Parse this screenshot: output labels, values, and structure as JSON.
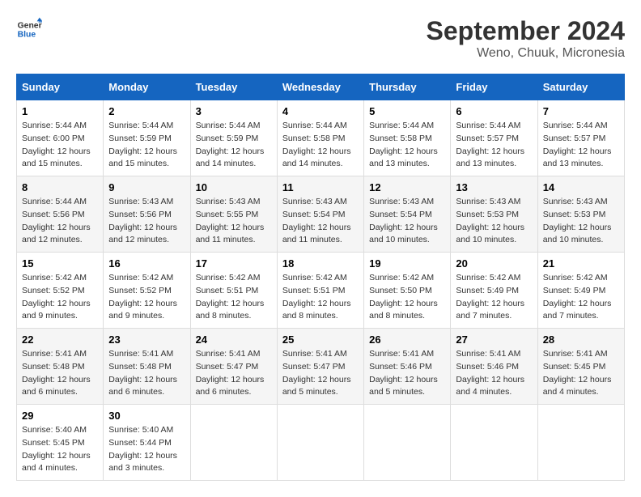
{
  "header": {
    "logo_line1": "General",
    "logo_line2": "Blue",
    "title": "September 2024",
    "subtitle": "Weno, Chuuk, Micronesia"
  },
  "columns": [
    "Sunday",
    "Monday",
    "Tuesday",
    "Wednesday",
    "Thursday",
    "Friday",
    "Saturday"
  ],
  "weeks": [
    [
      {
        "day": "1",
        "sunrise": "5:44 AM",
        "sunset": "6:00 PM",
        "daylight": "12 hours and 15 minutes."
      },
      {
        "day": "2",
        "sunrise": "5:44 AM",
        "sunset": "5:59 PM",
        "daylight": "12 hours and 15 minutes."
      },
      {
        "day": "3",
        "sunrise": "5:44 AM",
        "sunset": "5:59 PM",
        "daylight": "12 hours and 14 minutes."
      },
      {
        "day": "4",
        "sunrise": "5:44 AM",
        "sunset": "5:58 PM",
        "daylight": "12 hours and 14 minutes."
      },
      {
        "day": "5",
        "sunrise": "5:44 AM",
        "sunset": "5:58 PM",
        "daylight": "12 hours and 13 minutes."
      },
      {
        "day": "6",
        "sunrise": "5:44 AM",
        "sunset": "5:57 PM",
        "daylight": "12 hours and 13 minutes."
      },
      {
        "day": "7",
        "sunrise": "5:44 AM",
        "sunset": "5:57 PM",
        "daylight": "12 hours and 13 minutes."
      }
    ],
    [
      {
        "day": "8",
        "sunrise": "5:44 AM",
        "sunset": "5:56 PM",
        "daylight": "12 hours and 12 minutes."
      },
      {
        "day": "9",
        "sunrise": "5:43 AM",
        "sunset": "5:56 PM",
        "daylight": "12 hours and 12 minutes."
      },
      {
        "day": "10",
        "sunrise": "5:43 AM",
        "sunset": "5:55 PM",
        "daylight": "12 hours and 11 minutes."
      },
      {
        "day": "11",
        "sunrise": "5:43 AM",
        "sunset": "5:54 PM",
        "daylight": "12 hours and 11 minutes."
      },
      {
        "day": "12",
        "sunrise": "5:43 AM",
        "sunset": "5:54 PM",
        "daylight": "12 hours and 10 minutes."
      },
      {
        "day": "13",
        "sunrise": "5:43 AM",
        "sunset": "5:53 PM",
        "daylight": "12 hours and 10 minutes."
      },
      {
        "day": "14",
        "sunrise": "5:43 AM",
        "sunset": "5:53 PM",
        "daylight": "12 hours and 10 minutes."
      }
    ],
    [
      {
        "day": "15",
        "sunrise": "5:42 AM",
        "sunset": "5:52 PM",
        "daylight": "12 hours and 9 minutes."
      },
      {
        "day": "16",
        "sunrise": "5:42 AM",
        "sunset": "5:52 PM",
        "daylight": "12 hours and 9 minutes."
      },
      {
        "day": "17",
        "sunrise": "5:42 AM",
        "sunset": "5:51 PM",
        "daylight": "12 hours and 8 minutes."
      },
      {
        "day": "18",
        "sunrise": "5:42 AM",
        "sunset": "5:51 PM",
        "daylight": "12 hours and 8 minutes."
      },
      {
        "day": "19",
        "sunrise": "5:42 AM",
        "sunset": "5:50 PM",
        "daylight": "12 hours and 8 minutes."
      },
      {
        "day": "20",
        "sunrise": "5:42 AM",
        "sunset": "5:49 PM",
        "daylight": "12 hours and 7 minutes."
      },
      {
        "day": "21",
        "sunrise": "5:42 AM",
        "sunset": "5:49 PM",
        "daylight": "12 hours and 7 minutes."
      }
    ],
    [
      {
        "day": "22",
        "sunrise": "5:41 AM",
        "sunset": "5:48 PM",
        "daylight": "12 hours and 6 minutes."
      },
      {
        "day": "23",
        "sunrise": "5:41 AM",
        "sunset": "5:48 PM",
        "daylight": "12 hours and 6 minutes."
      },
      {
        "day": "24",
        "sunrise": "5:41 AM",
        "sunset": "5:47 PM",
        "daylight": "12 hours and 6 minutes."
      },
      {
        "day": "25",
        "sunrise": "5:41 AM",
        "sunset": "5:47 PM",
        "daylight": "12 hours and 5 minutes."
      },
      {
        "day": "26",
        "sunrise": "5:41 AM",
        "sunset": "5:46 PM",
        "daylight": "12 hours and 5 minutes."
      },
      {
        "day": "27",
        "sunrise": "5:41 AM",
        "sunset": "5:46 PM",
        "daylight": "12 hours and 4 minutes."
      },
      {
        "day": "28",
        "sunrise": "5:41 AM",
        "sunset": "5:45 PM",
        "daylight": "12 hours and 4 minutes."
      }
    ],
    [
      {
        "day": "29",
        "sunrise": "5:40 AM",
        "sunset": "5:45 PM",
        "daylight": "12 hours and 4 minutes."
      },
      {
        "day": "30",
        "sunrise": "5:40 AM",
        "sunset": "5:44 PM",
        "daylight": "12 hours and 3 minutes."
      },
      null,
      null,
      null,
      null,
      null
    ]
  ],
  "labels": {
    "sunrise_prefix": "Sunrise: ",
    "sunset_prefix": "Sunset: ",
    "daylight_prefix": "Daylight: "
  }
}
